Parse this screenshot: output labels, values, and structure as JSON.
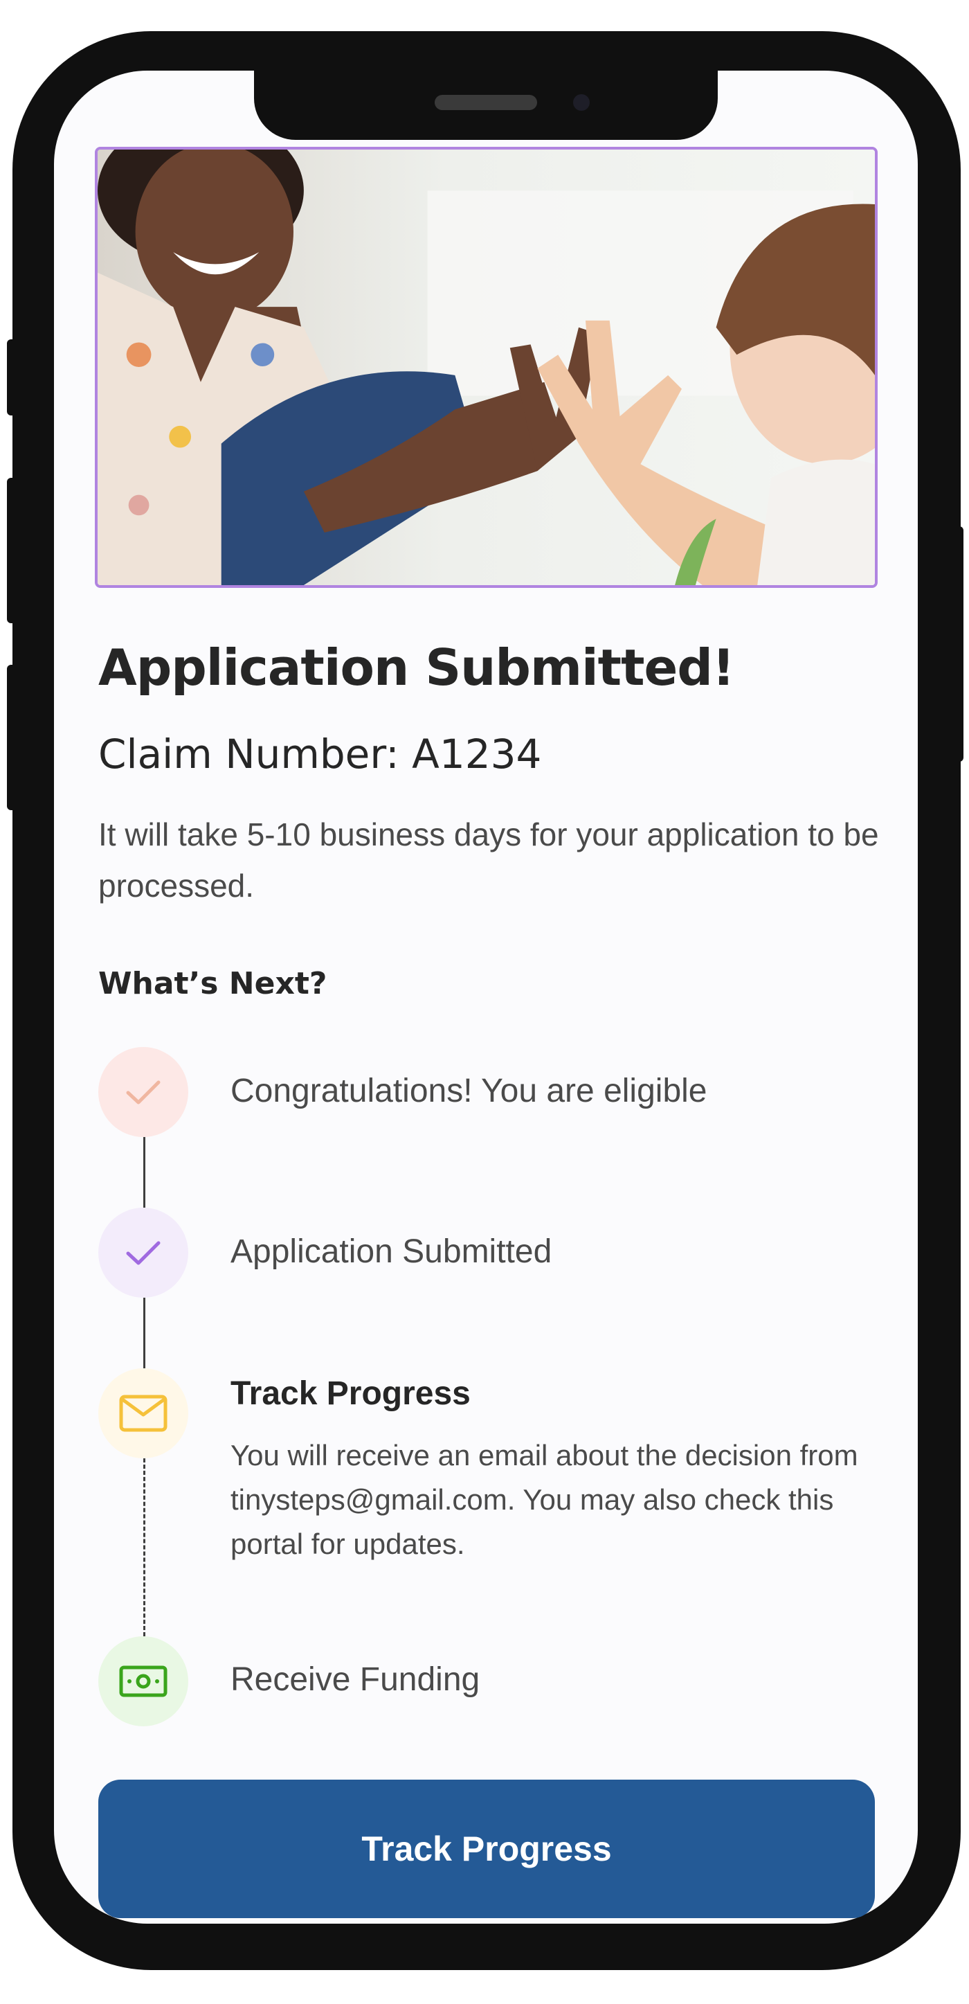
{
  "header": {
    "title": "Application Submitted!",
    "claim_number": "Claim Number: A1234",
    "description": "It will take 5-10 business days for your application to be processed."
  },
  "next_section": {
    "heading": "What’s Next?",
    "steps": [
      {
        "label": "Congratulations! You are eligible",
        "icon": "check-icon",
        "color": "#f0b6a0",
        "status": "completed"
      },
      {
        "label": "Application Submitted",
        "icon": "check-icon",
        "color": "#a06ae0",
        "status": "completed"
      },
      {
        "title": "Track Progress",
        "description": "You will receive an email about the decision from tinysteps@gmail.com. You may also check this portal for updates.",
        "icon": "mail-icon",
        "color": "#f5c13a",
        "status": "current"
      },
      {
        "label": "Receive Funding",
        "icon": "cash-icon",
        "color": "#3aa51c",
        "status": "upcoming"
      }
    ]
  },
  "cta": {
    "label": "Track Progress",
    "color": "#245a96"
  },
  "colors": {
    "accent_border": "#b084e0",
    "text_dark": "#262626",
    "text_body": "#4a4a4a"
  }
}
